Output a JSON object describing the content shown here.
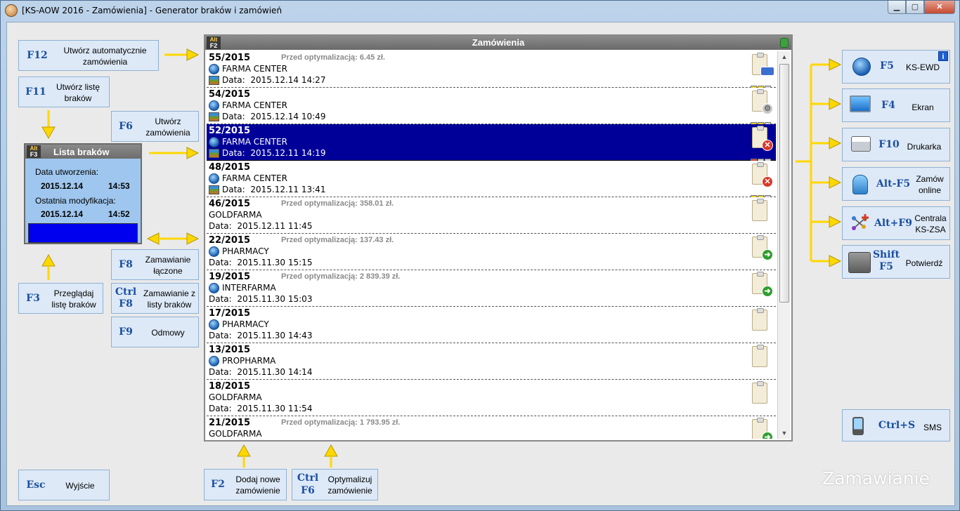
{
  "window": {
    "title": "[KS-AOW 2016 - Zamówienia] - Generator braków i zamówień",
    "min_glyph": "▁",
    "max_glyph": "▢",
    "close_glyph": "✕"
  },
  "left_buttons": {
    "f12": {
      "key": "F12",
      "label": "Utwórz automatycznie zamówienia"
    },
    "f11": {
      "key": "F11",
      "label": "Utwórz listę braków"
    },
    "f6": {
      "key": "F6",
      "label": "Utwórz zamówienia"
    },
    "f8": {
      "key": "F8",
      "label": "Zamawianie łączone"
    },
    "ctrl_f8": {
      "key_line1": "Ctrl",
      "key_line2": "F8",
      "label": "Zamawianie z listy braków"
    },
    "f9": {
      "key": "F9",
      "label": "Odmowy"
    },
    "f3": {
      "key": "F3",
      "label": "Przeglądaj listę braków"
    },
    "esc": {
      "key": "Esc",
      "label": "Wyjście"
    }
  },
  "lista_brakow": {
    "badge_alt": "Alt",
    "badge_key": "F3",
    "title": "Lista braków",
    "created_label": "Data utworzenia:",
    "created_date": "2015.12.14",
    "created_time": "14:53",
    "modified_label": "Ostatnia modyfikacja:",
    "modified_date": "2015.12.14",
    "modified_time": "14:52"
  },
  "orders_panel": {
    "badge_alt": "Alt",
    "badge_key": "F2",
    "title": "Zamówienia",
    "date_prefix": "Data:",
    "scroll_up": "▲",
    "scroll_down": "▼",
    "rows": [
      {
        "number": "55/2015",
        "optimization": "Przed optymalizacją: 6.45 zł.",
        "client": "FARMA CENTER",
        "date": "2015.12.14 14:27",
        "globe": true,
        "field": true,
        "status": "truck",
        "bars": "yyg",
        "selected": false
      },
      {
        "number": "54/2015",
        "optimization": "",
        "client": "FARMA CENTER",
        "date": "2015.12.14 10:49",
        "globe": true,
        "field": true,
        "status": "gear",
        "bars": "yyg",
        "selected": false
      },
      {
        "number": "52/2015",
        "optimization": "",
        "client": "FARMA CENTER",
        "date": "2015.12.11 14:19",
        "globe": true,
        "field": true,
        "status": "red",
        "bars": "rgg",
        "selected": true
      },
      {
        "number": "48/2015",
        "optimization": "",
        "client": "FARMA CENTER",
        "date": "2015.12.11 13:41",
        "globe": true,
        "field": true,
        "status": "red",
        "bars": "yyg",
        "selected": false
      },
      {
        "number": "46/2015",
        "optimization": "Przed optymalizacją: 358.01 zł.",
        "client": "GOLDFARMA",
        "date": "2015.12.11 11:45",
        "globe": false,
        "field": false,
        "status": "",
        "bars": "",
        "selected": false
      },
      {
        "number": "22/2015",
        "optimization": "Przed optymalizacją: 137.43 zł.",
        "client": "PHARMACY",
        "date": "2015.11.30 15:15",
        "globe": true,
        "field": false,
        "status": "green",
        "bars": "",
        "selected": false
      },
      {
        "number": "19/2015",
        "optimization": "Przed optymalizacją: 2 839.39 zł.",
        "client": "INTERFARMA",
        "date": "2015.11.30 15:03",
        "globe": true,
        "field": false,
        "status": "green",
        "bars": "",
        "selected": false
      },
      {
        "number": "17/2015",
        "optimization": "",
        "client": "PHARMACY",
        "date": "2015.11.30 14:43",
        "globe": true,
        "field": false,
        "status": "",
        "bars": "",
        "selected": false
      },
      {
        "number": "13/2015",
        "optimization": "",
        "client": "PROPHARMA",
        "date": "2015.11.30 14:14",
        "globe": true,
        "field": false,
        "status": "",
        "bars": "",
        "selected": false
      },
      {
        "number": "18/2015",
        "optimization": "",
        "client": "GOLDFARMA",
        "date": "2015.11.30 11:54",
        "globe": false,
        "field": false,
        "status": "",
        "bars": "",
        "selected": false
      },
      {
        "number": "21/2015",
        "optimization": "Przed optymalizacją: 1 793.95 zł.",
        "client": "GOLDFARMA",
        "date": "",
        "globe": false,
        "field": false,
        "status": "green",
        "bars": "",
        "selected": false
      }
    ]
  },
  "bottom_buttons": {
    "f2": {
      "key": "F2",
      "label": "Dodaj nowe zamówienie"
    },
    "ctrl_f6": {
      "key_line1": "Ctrl",
      "key_line2": "F6",
      "label": "Optymalizuj zamówienie"
    }
  },
  "right_buttons": {
    "f5": {
      "key": "F5",
      "label": "KS-EWD",
      "info": "i"
    },
    "f4": {
      "key": "F4",
      "label": "Ekran"
    },
    "f10": {
      "key": "F10",
      "label": "Drukarka"
    },
    "alt_f5": {
      "key": "Alt-F5",
      "label": "Zamów online"
    },
    "alt_f9": {
      "key": "Alt+F9",
      "label": "Centrala KS-ZSA"
    },
    "shift_f5": {
      "key_line1": "Shift",
      "key_line2": "F5",
      "label": "Potwierdź"
    },
    "ctrl_s": {
      "key": "Ctrl+S",
      "label": "SMS"
    }
  },
  "watermark": "Zamawianie",
  "colors": {
    "selected_row": "#000099",
    "arrow": "#ffd700",
    "key_text": "#1b4fa0"
  }
}
